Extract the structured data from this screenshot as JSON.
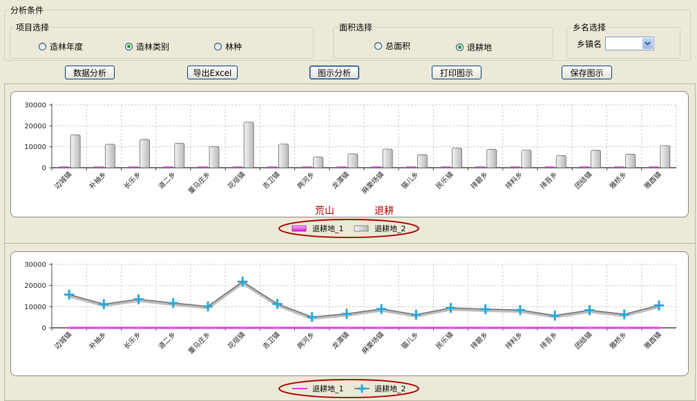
{
  "analysis_conditions": {
    "title": "分析条件",
    "project": {
      "title": "项目选择",
      "options": [
        "造林年度",
        "造林类别",
        "林种"
      ],
      "selected": 1
    },
    "area": {
      "title": "面积选择",
      "options": [
        "总面积",
        "退耕地"
      ],
      "selected": 1
    },
    "township": {
      "title": "乡名选择",
      "label": "乡镇名",
      "value": ""
    }
  },
  "toolbar": {
    "data_analysis": "数据分析",
    "export_excel": "导出Excel",
    "chart_analysis": "图示分析",
    "print_chart": "打印图示",
    "save_chart": "保存图示"
  },
  "annotations": {
    "label_1": "荒山",
    "label_2": "退耕"
  },
  "chart_data": [
    {
      "type": "bar",
      "categories": [
        "边城镇",
        "补抽乡",
        "长乐乡",
        "道二乡",
        "董马庄乡",
        "花垣镇",
        "吉卫镇",
        "两河乡",
        "龙潭镇",
        "麻栗场镇",
        "猫儿乡",
        "民乐镇",
        "排碧乡",
        "排料乡",
        "排吾乡",
        "团结镇",
        "雅桥乡",
        "雅酉镇"
      ],
      "series": [
        {
          "name": "退耕地_1",
          "values": [
            0,
            0,
            0,
            0,
            0,
            0,
            0,
            0,
            0,
            0,
            0,
            0,
            0,
            0,
            0,
            0,
            0,
            0
          ],
          "color": "#e040e0"
        },
        {
          "name": "退耕地_2",
          "values": [
            15700,
            11200,
            13500,
            11700,
            10100,
            21800,
            11300,
            5100,
            6600,
            8900,
            6200,
            9400,
            8800,
            8400,
            5800,
            8300,
            6400,
            10600
          ],
          "color": "#d8d8d8"
        }
      ],
      "ylim": [
        0,
        30000
      ],
      "yticks": [
        "0",
        "10000",
        "20000",
        "30000"
      ],
      "grid": true,
      "legend": "bottom"
    },
    {
      "type": "line",
      "categories": [
        "边城镇",
        "补抽乡",
        "长乐乡",
        "道二乡",
        "董马庄乡",
        "花垣镇",
        "吉卫镇",
        "两河乡",
        "龙潭镇",
        "麻栗场镇",
        "猫儿乡",
        "民乐镇",
        "排碧乡",
        "排料乡",
        "排吾乡",
        "团结镇",
        "雅桥乡",
        "雅酉镇"
      ],
      "series": [
        {
          "name": "退耕地_1",
          "values": [
            0,
            0,
            0,
            0,
            0,
            0,
            0,
            0,
            0,
            0,
            0,
            0,
            0,
            0,
            0,
            0,
            0,
            0
          ],
          "color": "#e040e0"
        },
        {
          "name": "退耕地_2",
          "values": [
            15700,
            11200,
            13500,
            11700,
            10100,
            21800,
            11300,
            5100,
            6600,
            8900,
            6200,
            9400,
            8800,
            8400,
            5800,
            8300,
            6400,
            10600
          ],
          "color": "#2aa7d9"
        }
      ],
      "ylim": [
        0,
        30000
      ],
      "yticks": [
        "0",
        "10000",
        "20000",
        "30000"
      ],
      "grid": true,
      "legend": "bottom"
    }
  ]
}
